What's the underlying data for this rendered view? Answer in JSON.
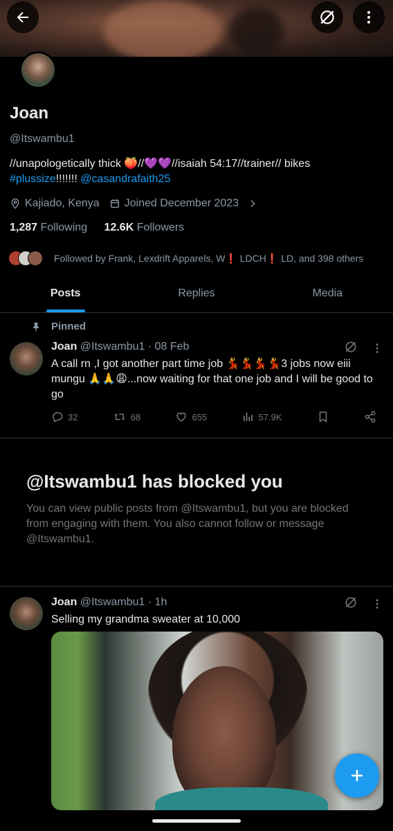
{
  "profile": {
    "name": "Joan",
    "handle": "@Itswambu1",
    "bio_line1": "//unapologetically thick 🍑//💜💜//isaiah 54:17//trainer// bikes",
    "bio_hashtag": "#plussize",
    "bio_exclaim": "!!!!!!! ",
    "bio_mention": "@casandrafaith25",
    "location": "Kajiado, Kenya",
    "joined": "Joined December 2023",
    "following_count": "1,287",
    "following_label": "Following",
    "followers_count": "12.6K",
    "followers_label": "Followers",
    "followed_by": "Followed by Frank, Lexdrift Apparels, W❗ LDCH❗ LD, and 398 others"
  },
  "tabs": [
    {
      "label": "Posts",
      "active": true
    },
    {
      "label": "Replies",
      "active": false
    },
    {
      "label": "Media",
      "active": false
    }
  ],
  "pinned_post": {
    "pinned_label": "Pinned",
    "author": "Joan",
    "meta": "@Itswambu1 · 08 Feb",
    "text": "A call rn ,I got another part time job 💃💃💃💃3 jobs now eiii mungu 🙏🙏😩...now waiting for that one job and I will be good to go",
    "replies": "32",
    "reposts": "68",
    "likes": "655",
    "views": "57.9K"
  },
  "blocked": {
    "title": "@Itswambu1 has blocked you",
    "text": "You can view public posts from @Itswambu1, but you are blocked from engaging with them. You also cannot follow or message @Itswambu1."
  },
  "second_post": {
    "author": "Joan",
    "meta": "@Itswambu1 · 1h",
    "text": "Selling my grandma sweater at 10,000"
  },
  "icons": {
    "back": "arrow-left-icon",
    "grok": "grok-icon",
    "more": "more-vertical-icon",
    "location": "location-pin-icon",
    "calendar": "calendar-icon",
    "pin": "pin-icon",
    "reply": "reply-icon",
    "repost": "repost-icon",
    "like": "heart-icon",
    "views": "views-icon",
    "bookmark": "bookmark-icon",
    "share": "share-icon",
    "compose": "plus-icon"
  },
  "colors": {
    "accent": "#1d9bf0",
    "background": "#000000",
    "text_primary": "#e7e9ea",
    "text_secondary": "#8b98a5"
  }
}
